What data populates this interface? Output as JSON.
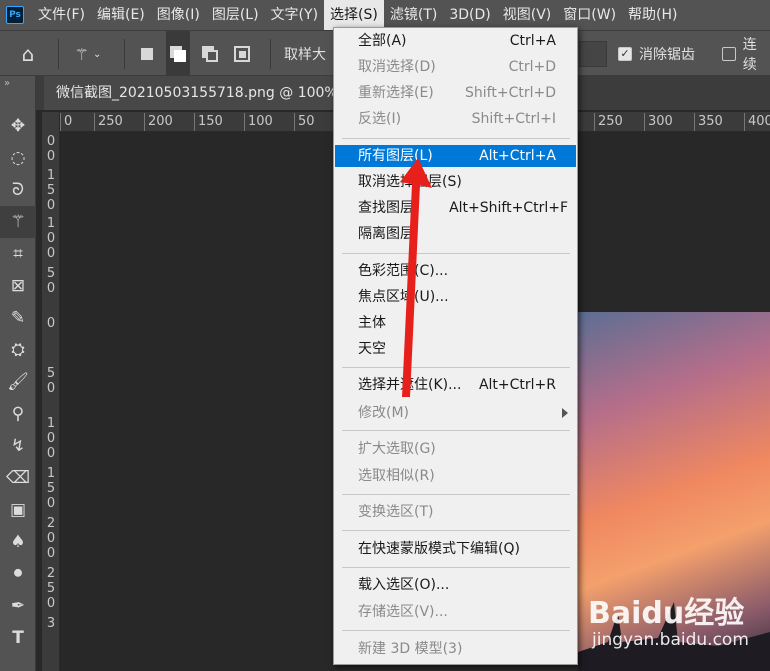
{
  "menubar": {
    "logo": "Ps",
    "items": [
      "文件(F)",
      "编辑(E)",
      "图像(I)",
      "图层(L)",
      "文字(Y)",
      "选择(S)",
      "滤镜(T)",
      "3D(D)",
      "视图(V)",
      "窗口(W)",
      "帮助(H)"
    ],
    "active": "选择(S)"
  },
  "options": {
    "sample_label": "取样大",
    "antialias_label": "消除锯齿",
    "contiguous_label": "连续",
    "antialias_checked": true,
    "contiguous_checked": false
  },
  "document": {
    "tab_title": "微信截图_20210503155718.png @ 100% ("
  },
  "ruler": {
    "top_left": [
      "0",
      "250",
      "200",
      "150",
      "100",
      "50"
    ],
    "top_right": [
      "250",
      "300",
      "350",
      "400"
    ],
    "left_groups": [
      [
        "0",
        "0"
      ],
      [
        "1",
        "5",
        "0"
      ],
      [
        "1",
        "0",
        "0"
      ],
      [
        "5",
        "0"
      ],
      [
        "0"
      ],
      [
        "5",
        "0"
      ],
      [
        "1",
        "0",
        "0"
      ],
      [
        "1",
        "5",
        "0"
      ],
      [
        "2",
        "0",
        "0"
      ],
      [
        "2",
        "5",
        "0"
      ],
      [
        "3"
      ]
    ]
  },
  "dropdown": {
    "items": [
      {
        "label": "全部(A)",
        "shortcut": "Ctrl+A",
        "disabled": false
      },
      {
        "label": "取消选择(D)",
        "shortcut": "Ctrl+D",
        "disabled": true
      },
      {
        "label": "重新选择(E)",
        "shortcut": "Shift+Ctrl+D",
        "disabled": true
      },
      {
        "label": "反选(I)",
        "shortcut": "Shift+Ctrl+I",
        "disabled": true
      },
      {
        "label": "所有图层(L)",
        "shortcut": "Alt+Ctrl+A",
        "disabled": false,
        "highlighted": true
      },
      {
        "label": "取消选择图层(S)",
        "shortcut": "",
        "disabled": false
      },
      {
        "label": "查找图层",
        "shortcut": "Alt+Shift+Ctrl+F",
        "disabled": false
      },
      {
        "label": "隔离图层",
        "shortcut": "",
        "disabled": false
      },
      {
        "label": "色彩范围(C)...",
        "shortcut": "",
        "disabled": false
      },
      {
        "label": "焦点区域(U)...",
        "shortcut": "",
        "disabled": false
      },
      {
        "label": "主体",
        "shortcut": "",
        "disabled": false
      },
      {
        "label": "天空",
        "shortcut": "",
        "disabled": false
      },
      {
        "label": "选择并遮住(K)...",
        "shortcut": "Alt+Ctrl+R",
        "disabled": false
      },
      {
        "label": "修改(M)",
        "shortcut": "",
        "disabled": true,
        "submenu": true
      },
      {
        "label": "扩大选取(G)",
        "shortcut": "",
        "disabled": true
      },
      {
        "label": "选取相似(R)",
        "shortcut": "",
        "disabled": true
      },
      {
        "label": "变换选区(T)",
        "shortcut": "",
        "disabled": true
      },
      {
        "label": "在快速蒙版模式下编辑(Q)",
        "shortcut": "",
        "disabled": false
      },
      {
        "label": "载入选区(O)...",
        "shortcut": "",
        "disabled": false
      },
      {
        "label": "存储选区(V)...",
        "shortcut": "",
        "disabled": true
      },
      {
        "label": "新建 3D 模型(3)",
        "shortcut": "",
        "disabled": true
      }
    ]
  },
  "watermark": {
    "logo": "Baidu经验",
    "url": "jingyan.baidu.com"
  },
  "colors": {
    "highlight": "#0078d7",
    "annotation_arrow": "#e8201c"
  }
}
